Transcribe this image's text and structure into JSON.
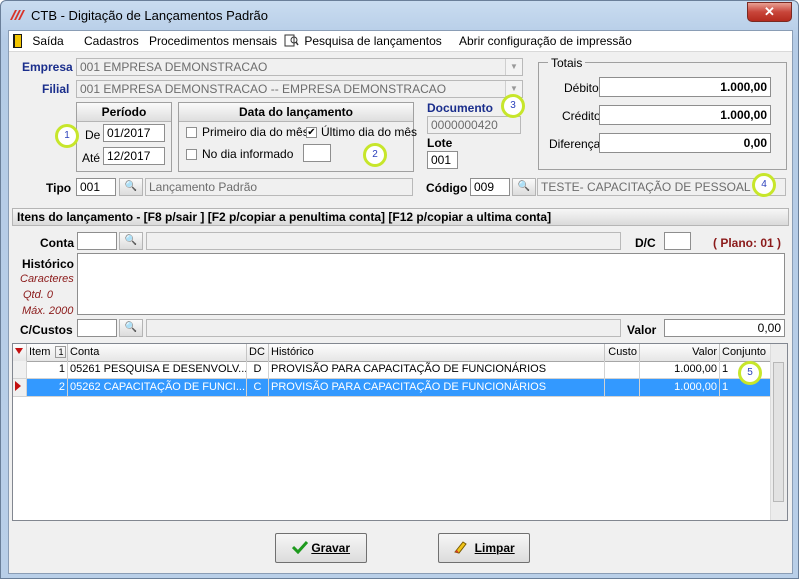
{
  "window": {
    "title": "CTB - Digitação de Lançamentos Padrão",
    "close_label": "✕"
  },
  "menu": {
    "items": [
      "Saída",
      "Cadastros",
      "Procedimentos mensais",
      "Pesquisa de lançamentos",
      "Abrir configuração de impressão"
    ]
  },
  "header": {
    "empresa_label": "Empresa",
    "empresa_value": "001 EMPRESA DEMONSTRACAO",
    "filial_label": "Filial",
    "filial_value": "001 EMPRESA DEMONSTRACAO -- EMPRESA DEMONSTRACAO"
  },
  "periodo": {
    "title": "Período",
    "de_label": "De",
    "de_value": "01/2017",
    "ate_label": "Até",
    "ate_value": "12/2017"
  },
  "data_lancamento": {
    "title": "Data do lançamento",
    "primeiro_label": "Primeiro dia do mês",
    "primeiro_checked": false,
    "ultimo_label": "Último dia do mês",
    "ultimo_checked": true,
    "informado_label": "No dia informado",
    "informado_checked": false,
    "informado_value": ""
  },
  "documento": {
    "label": "Documento",
    "value": "0000000420",
    "lote_label": "Lote",
    "lote_value": "001"
  },
  "totais": {
    "title": "Totais",
    "debito_label": "Débito",
    "debito_value": "1.000,00",
    "credito_label": "Crédito",
    "credito_value": "1.000,00",
    "diferenca_label": "Diferença",
    "diferenca_value": "0,00"
  },
  "tipo": {
    "label": "Tipo",
    "code": "001",
    "desc": "Lançamento Padrão"
  },
  "codigo": {
    "label": "Código",
    "code": "009",
    "desc": "TESTE- CAPACITAÇÃO DE PESSOAL"
  },
  "itens": {
    "section_title": "Itens do lançamento - [F8 p/sair ]  [F2 p/copiar a penultima conta]  [F12 p/copiar a ultima conta]",
    "conta_label": "Conta",
    "dc_label": "D/C",
    "plano_label": "( Plano: 01 )",
    "historico_label": "Histórico",
    "caracteres_label": "Caracteres",
    "qtd_label": "Qtd. 0",
    "max_label": "Máx. 2000",
    "ccustos_label": "C/Custos",
    "valor_label": "Valor",
    "valor_value": "0,00"
  },
  "grid": {
    "columns": [
      "Item",
      "Conta",
      "DC",
      "Histórico",
      "Custo",
      "Valor",
      "Conjunto"
    ],
    "sort_indicator": "1",
    "rows": [
      {
        "item": "1",
        "conta": "05261 PESQUISA E DESENVOLV...",
        "dc": "D",
        "historico": "PROVISÃO PARA CAPACITAÇÃO DE FUNCIONÁRIOS",
        "custo": "",
        "valor": "1.000,00",
        "conjunto": "1"
      },
      {
        "item": "2",
        "conta": "05262 CAPACITAÇÃO DE FUNCI...",
        "dc": "C",
        "historico": "PROVISÃO PARA CAPACITAÇÃO DE FUNCIONÁRIOS",
        "custo": "",
        "valor": "1.000,00",
        "conjunto": "1"
      }
    ]
  },
  "markers": [
    "1",
    "2",
    "3",
    "4",
    "5"
  ],
  "buttons": {
    "gravar": "Gravar",
    "limpar": "Limpar"
  },
  "colors": {
    "accent": "#3399ff",
    "marker": "#c7e62b",
    "label_blue": "#1a2e8c",
    "plano_red": "#8b1a1a"
  }
}
